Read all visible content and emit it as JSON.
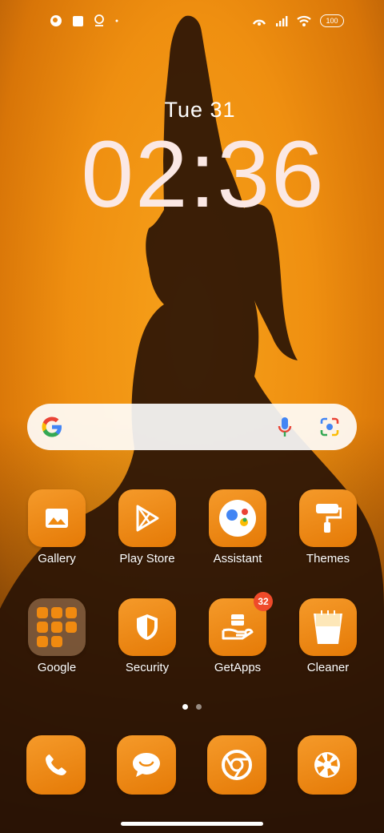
{
  "status_bar": {
    "icons_left": [
      "app-notification-icon",
      "square-notification-icon",
      "location-icon",
      "dot-icon"
    ],
    "icons_right": [
      "hotspot-icon",
      "signal-icon",
      "wifi-icon"
    ],
    "battery": "100"
  },
  "lockscreen": {
    "date": "Tue 31",
    "time": "02:36"
  },
  "search": {
    "icons": [
      "google-logo-icon",
      "mic-icon",
      "lens-icon"
    ]
  },
  "apps_row1": [
    {
      "label": "Gallery",
      "icon": "gallery-icon"
    },
    {
      "label": "Play Store",
      "icon": "play-store-icon"
    },
    {
      "label": "Assistant",
      "icon": "assistant-icon"
    },
    {
      "label": "Themes",
      "icon": "themes-icon"
    }
  ],
  "apps_row2": [
    {
      "label": "Google",
      "icon": "google-folder-icon"
    },
    {
      "label": "Security",
      "icon": "security-icon"
    },
    {
      "label": "GetApps",
      "icon": "getapps-icon",
      "badge": "32"
    },
    {
      "label": "Cleaner",
      "icon": "cleaner-icon"
    }
  ],
  "page_indicator": {
    "pages": 2,
    "current": 1
  },
  "dock": [
    {
      "icon": "phone-icon"
    },
    {
      "icon": "messages-icon"
    },
    {
      "icon": "chrome-icon"
    },
    {
      "icon": "camera-icon"
    }
  ],
  "colors": {
    "tile": "#ef8a10",
    "badge": "#ef4a2a",
    "clock": "#fbe8e4"
  }
}
